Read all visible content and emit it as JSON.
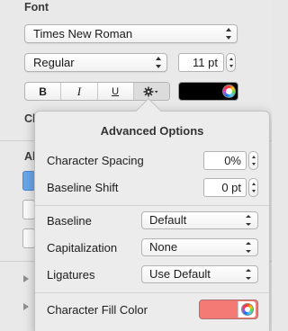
{
  "font_section": {
    "title": "Font",
    "family": "Times New Roman",
    "typeface": "Regular",
    "size": "11 pt",
    "style_buttons": {
      "bold": "B",
      "italic": "I",
      "underline": "U"
    },
    "gear_icon": "gear-icon",
    "text_color": "#000000"
  },
  "background_partials": {
    "char_label": "Ch",
    "al_label": "Al"
  },
  "advanced_options": {
    "title": "Advanced Options",
    "character_spacing": {
      "label": "Character Spacing",
      "value": "0%"
    },
    "baseline_shift": {
      "label": "Baseline Shift",
      "value": "0 pt"
    },
    "baseline": {
      "label": "Baseline",
      "value": "Default"
    },
    "capitalization": {
      "label": "Capitalization",
      "value": "None"
    },
    "ligatures": {
      "label": "Ligatures",
      "value": "Use Default"
    },
    "character_fill_color": {
      "label": "Character Fill Color",
      "color": "#f47a75"
    }
  }
}
